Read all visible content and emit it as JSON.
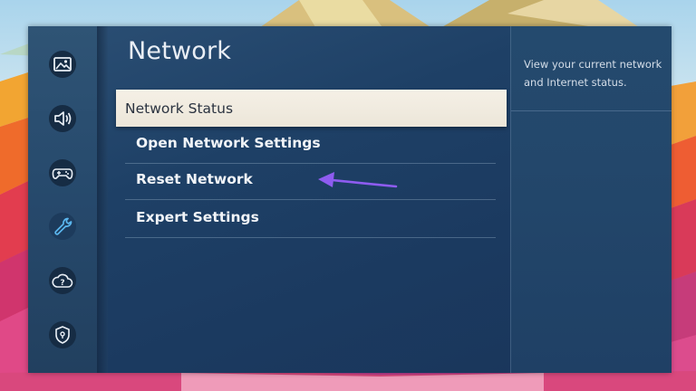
{
  "sidebar": {
    "items": [
      {
        "icon": "picture-icon"
      },
      {
        "icon": "sound-icon"
      },
      {
        "icon": "gamepad-icon"
      },
      {
        "icon": "wrench-icon"
      },
      {
        "icon": "cloud-help-icon"
      },
      {
        "icon": "shield-lock-icon"
      }
    ]
  },
  "main": {
    "title": "Network",
    "menu": [
      {
        "label": "Network Status",
        "selected": true
      },
      {
        "label": "Open Network Settings",
        "selected": false
      },
      {
        "label": "Reset Network",
        "selected": false
      },
      {
        "label": "Expert Settings",
        "selected": false
      }
    ]
  },
  "info": {
    "description": "View your current network and Internet status."
  },
  "colors": {
    "panel_bg": "#1e4066",
    "selected_bg": "#f1ece1",
    "arrow": "#8e5cf0"
  }
}
